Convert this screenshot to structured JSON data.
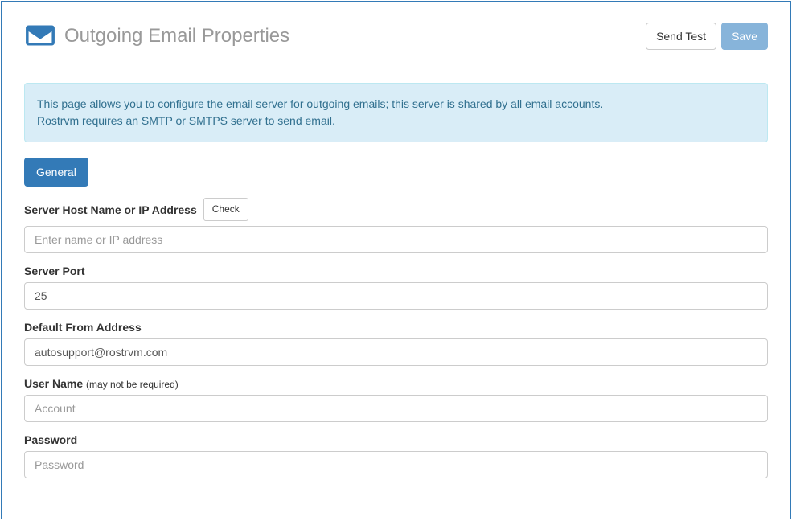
{
  "header": {
    "title": "Outgoing Email Properties",
    "send_test_label": "Send Test",
    "save_label": "Save"
  },
  "info": {
    "line1": "This page allows you to configure the email server for outgoing emails; this server is shared by all email accounts.",
    "line2": "Rostrvm requires an SMTP or SMTPS server to send email."
  },
  "tabs": {
    "general_label": "General"
  },
  "form": {
    "host": {
      "label": "Server Host Name or IP Address",
      "check_label": "Check",
      "placeholder": "Enter name or IP address",
      "value": ""
    },
    "port": {
      "label": "Server Port",
      "value": "25"
    },
    "from": {
      "label": "Default From Address",
      "value": "autosupport@rostrvm.com"
    },
    "user": {
      "label": "User Name",
      "note": "(may not be required)",
      "placeholder": "Account",
      "value": ""
    },
    "password": {
      "label": "Password",
      "placeholder": "Password",
      "value": ""
    }
  }
}
